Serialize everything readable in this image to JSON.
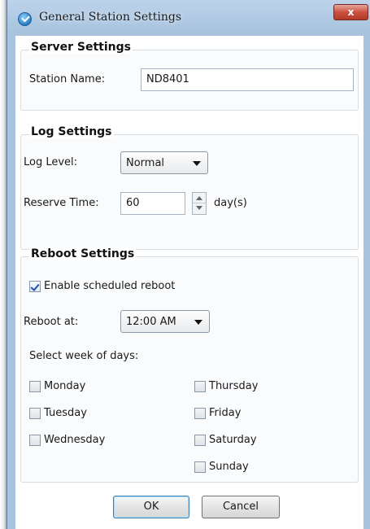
{
  "window": {
    "title": "General Station Settings",
    "close_label": "x"
  },
  "server": {
    "title": "Server Settings",
    "station_name_label": "Station Name:",
    "station_name_value": "ND8401"
  },
  "log": {
    "title": "Log Settings",
    "level_label": "Log Level:",
    "level_value": "Normal",
    "reserve_label": "Reserve Time:",
    "reserve_value": "60",
    "reserve_unit": "day(s)"
  },
  "reboot": {
    "title": "Reboot Settings",
    "enable_label": "Enable scheduled reboot",
    "enable_checked": true,
    "at_label": "Reboot at:",
    "at_value": "12:00 AM",
    "week_label": "Select week of days:",
    "days": [
      {
        "label": "Monday",
        "checked": false
      },
      {
        "label": "Tuesday",
        "checked": false
      },
      {
        "label": "Wednesday",
        "checked": false
      },
      {
        "label": "Thursday",
        "checked": false
      },
      {
        "label": "Friday",
        "checked": false
      },
      {
        "label": "Saturday",
        "checked": false
      },
      {
        "label": "Sunday",
        "checked": false
      }
    ]
  },
  "buttons": {
    "ok": "OK",
    "cancel": "Cancel"
  },
  "colors": {
    "title_bar": "#a9c3de",
    "close_button": "#c9523f",
    "default_button_border": "#3c7fb1"
  }
}
